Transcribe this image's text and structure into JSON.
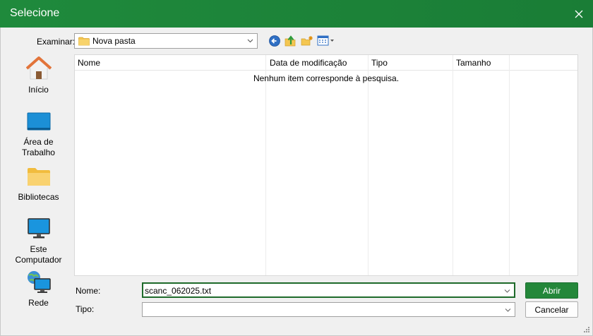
{
  "window": {
    "title": "Selecione"
  },
  "toolbar": {
    "examinar_label": "Examinar:",
    "current_folder": "Nova pasta"
  },
  "places": [
    {
      "label_line1": "Início",
      "label_line2": "",
      "icon": "home-icon"
    },
    {
      "label_line1": "Área de",
      "label_line2": "Trabalho",
      "icon": "desktop-icon"
    },
    {
      "label_line1": "Bibliotecas",
      "label_line2": "",
      "icon": "folder-icon"
    },
    {
      "label_line1": "Este",
      "label_line2": "Computador",
      "icon": "computer-icon"
    },
    {
      "label_line1": "Rede",
      "label_line2": "",
      "icon": "network-icon"
    }
  ],
  "list": {
    "columns": [
      "Nome",
      "Data de modificação",
      "Tipo",
      "Tamanho"
    ],
    "empty_message": "Nenhum item corresponde à pesquisa."
  },
  "footer": {
    "nome_label": "Nome:",
    "nome_value": "scanc_062025.txt",
    "tipo_label": "Tipo:",
    "tipo_value": "",
    "open_button": "Abrir",
    "cancel_button": "Cancelar"
  },
  "colors": {
    "accent": "#24873a",
    "titlebar": "#1f8a3c"
  }
}
